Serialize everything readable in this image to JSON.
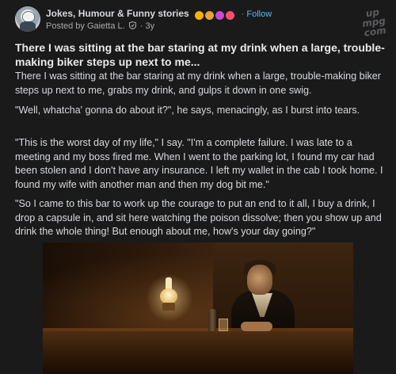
{
  "header": {
    "group_name": "Jokes, Humour & Funny stories",
    "separator": "·",
    "follow_label": "Follow",
    "posted_by": "Posted by Gaietta L.",
    "age": "· 3y",
    "emojis": [
      {
        "icon": "laughing-emoji-icon",
        "color": "#f4b400"
      },
      {
        "icon": "cat-emoji-icon",
        "color": "#e8a33a"
      },
      {
        "icon": "party-emoji-icon",
        "color": "#c54bd0"
      },
      {
        "icon": "grin-emoji-icon",
        "color": "#ff4d6d"
      }
    ]
  },
  "watermark": {
    "line1": "up",
    "line2": "mpg",
    "line3": "com"
  },
  "post": {
    "title": "There I was sitting at the bar staring at my drink when a large, trouble-making biker steps up next to me...",
    "paragraphs": [
      "There I was sitting at the bar staring at my drink when a large, trouble-making biker steps up next to me, grabs my drink, and gulps it down in one swig.",
      "\"Well, whatcha' gonna do about it?\", he says, menacingly, as I burst into tears.",
      "\"This is the worst day of my life,\" I say. \"I'm a complete failure. I was late to a meeting and my boss fired me. When I went to the parking lot, I found my car had been stolen and I don't have any insurance. I left my wallet in the cab I took home. I found my wife with another man and then my dog bit me.\"",
      "\"So I came to this bar to work up the courage to put an end to it all, I buy a drink, I drop a capsule in, and sit here watching the poison dissolve; then you show up and drink the whole thing! But enough about me, how's your day going?\""
    ]
  },
  "colors": {
    "background": "#1a1a1b",
    "text": "#d7dadc",
    "follow": "#4fbcff"
  }
}
